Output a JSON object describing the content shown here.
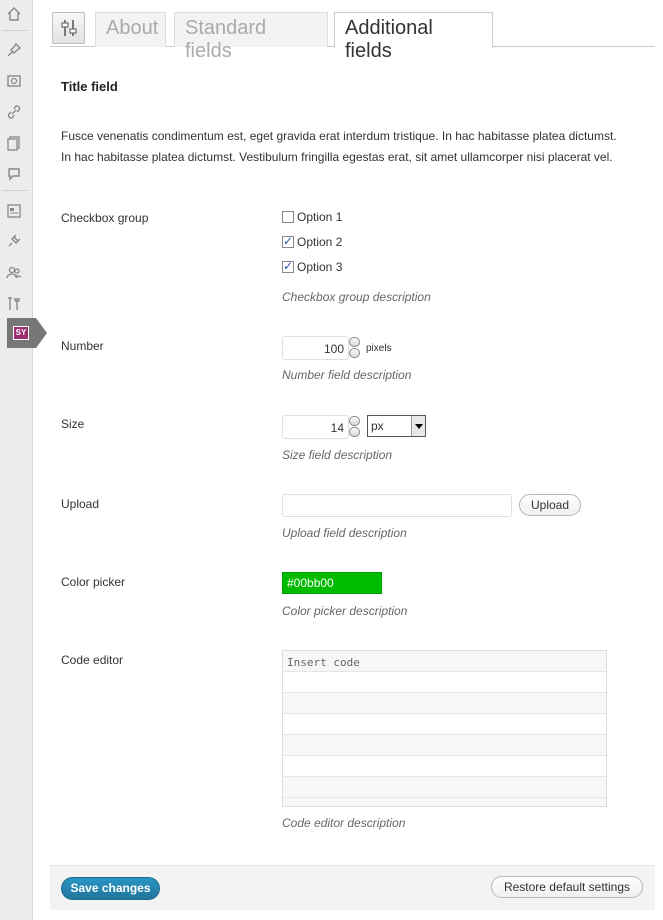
{
  "tabs": {
    "items": [
      {
        "label": "About",
        "active": false
      },
      {
        "label": "Standard fields",
        "active": false
      },
      {
        "label": "Additional fields",
        "active": true
      }
    ]
  },
  "sidebar": {
    "items": [
      {
        "icon": "dashboard-icon"
      },
      {
        "icon": "posts-pin-icon"
      },
      {
        "icon": "media-icon"
      },
      {
        "icon": "links-icon"
      },
      {
        "icon": "pages-icon"
      },
      {
        "icon": "comments-icon"
      },
      {
        "icon": "appearance-icon"
      },
      {
        "icon": "plugins-icon"
      },
      {
        "icon": "users-icon"
      },
      {
        "icon": "tools-icon"
      },
      {
        "icon": "settings-plugin-icon",
        "badge": "SY"
      }
    ]
  },
  "content": {
    "section_title": "Title field",
    "intro_line1": "Fusce venenatis condimentum est, eget gravida erat interdum tristique. In hac habitasse platea dictumst.",
    "intro_line2": "In hac habitasse platea dictumst. Vestibulum fringilla egestas erat, sit amet ullamcorper nisi placerat vel."
  },
  "fields": {
    "checkbox_group": {
      "label": "Checkbox group",
      "options": [
        {
          "label": "Option 1",
          "checked": false
        },
        {
          "label": "Option 2",
          "checked": true
        },
        {
          "label": "Option 3",
          "checked": true
        }
      ],
      "description": "Checkbox group description"
    },
    "number": {
      "label": "Number",
      "value": "100",
      "unit": "pixels",
      "description": "Number field description"
    },
    "size": {
      "label": "Size",
      "value": "14",
      "unit_selected": "px",
      "description": "Size field description"
    },
    "upload": {
      "label": "Upload",
      "value": "",
      "button_label": "Upload",
      "description": "Upload field description"
    },
    "color_picker": {
      "label": "Color picker",
      "value": "#00bb00",
      "description": "Color picker description"
    },
    "code_editor": {
      "label": "Code editor",
      "placeholder": "Insert code",
      "description": "Code editor description"
    }
  },
  "footer": {
    "save_label": "Save changes",
    "restore_label": "Restore default settings"
  },
  "colors": {
    "accent": "#21759b",
    "picker_swatch": "#00bb00",
    "sidebar_active": "#777777",
    "badge": "#9b2d6e"
  }
}
